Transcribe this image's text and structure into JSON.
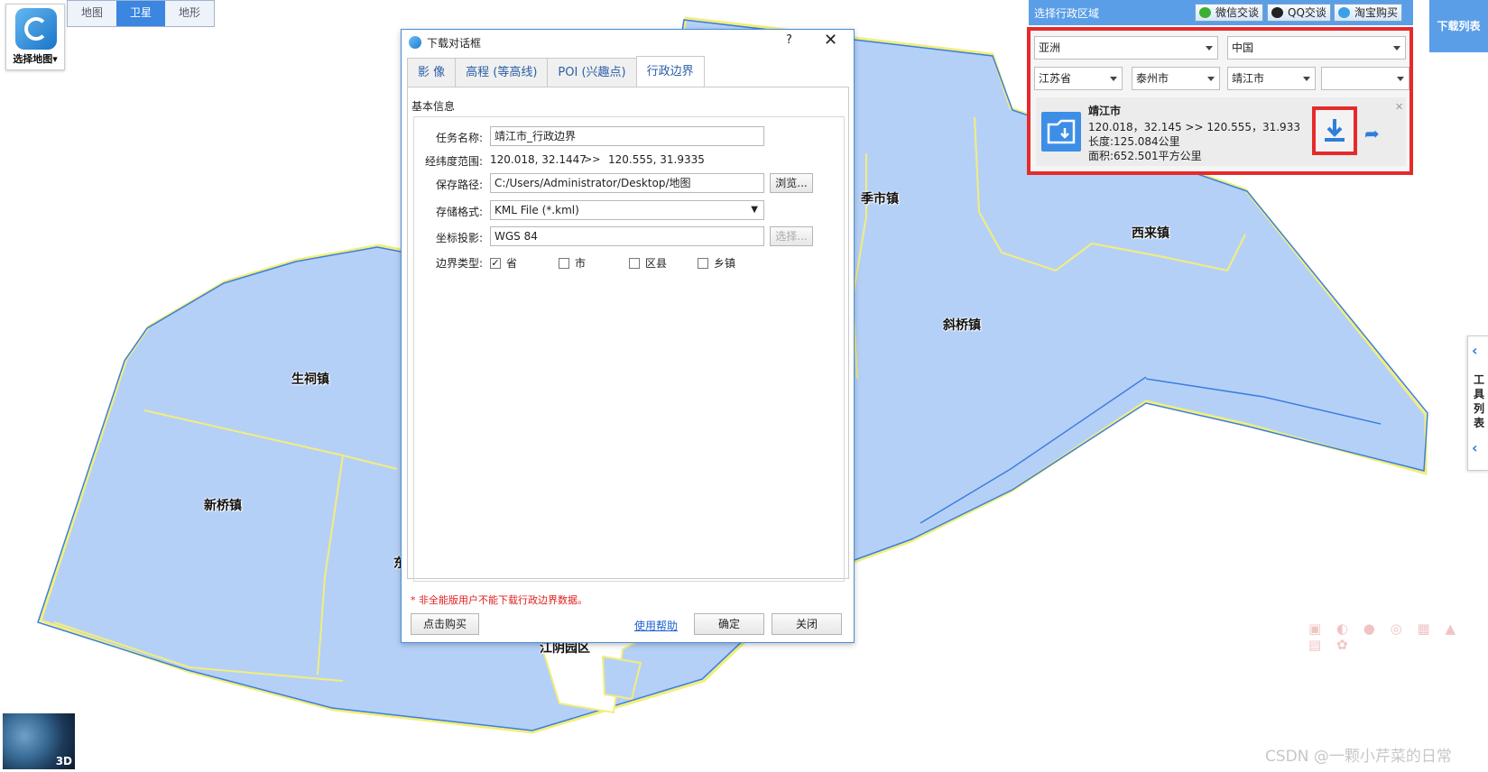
{
  "map": {
    "chooser_label": "选择地图",
    "map_types": [
      "地图",
      "卫星",
      "地形"
    ],
    "active_map_type": "卫星",
    "place_labels": [
      "季市镇",
      "西来镇",
      "斜桥镇",
      "生祠镇",
      "新桥镇",
      "江阴园区",
      "东"
    ]
  },
  "dialog": {
    "title": "下载对话框",
    "help": "?",
    "close": "✕",
    "tabs": [
      "影 像",
      "高程 (等高线)",
      "POI (兴趣点)",
      "行政边界"
    ],
    "section_title": "基本信息",
    "task_label": "任务名称:",
    "task_value": "靖江市_行政边界",
    "range_label": "经纬度范围:",
    "range_from": "120.018, 32.1447",
    "range_sep": ">>",
    "range_to": "120.555, 31.9335",
    "path_label": "保存路径:",
    "path_value": "C:/Users/Administrator/Desktop/地图",
    "browse": "浏览...",
    "format_label": "存储格式:",
    "format_value": "KML File (*.kml)",
    "proj_label": "坐标投影:",
    "proj_value": "WGS 84",
    "proj_select": "选择...",
    "boundary_label": "边界类型:",
    "boundary_options": [
      {
        "label": "省",
        "checked": true
      },
      {
        "label": "市",
        "checked": false
      },
      {
        "label": "区县",
        "checked": false
      },
      {
        "label": "乡镇",
        "checked": false
      }
    ],
    "warning": "* 非全能版用户不能下载行政边界数据。",
    "buy": "点击购买",
    "help_link": "使用帮助",
    "ok": "确定",
    "close_btn": "关闭"
  },
  "region": {
    "title": "选择行政区域",
    "wechat": "微信交谈",
    "qq": "QQ交谈",
    "taobao": "淘宝购买",
    "continent": "亚洲",
    "country": "中国",
    "province": "江苏省",
    "city": "泰州市",
    "county": "靖江市",
    "town": "",
    "result": {
      "name": "靖江市",
      "coords": "120.018，32.145 >> 120.555，31.933",
      "length": "长度:125.084公里",
      "area": "面积:652.501平方公里"
    }
  },
  "download_list": "下载列表",
  "tool_list": [
    "工",
    "具",
    "列",
    "表"
  ],
  "mini_3d": "3D",
  "watermark": "CSDN @一颗小芹菜的日常",
  "colors": {
    "accent": "#5a9ee8",
    "region_fill": "#b5d0f7",
    "region_stroke_blue": "#3b7fe0",
    "region_stroke_yellow": "#f2ee7a",
    "highlight_red": "#e62a2a"
  }
}
